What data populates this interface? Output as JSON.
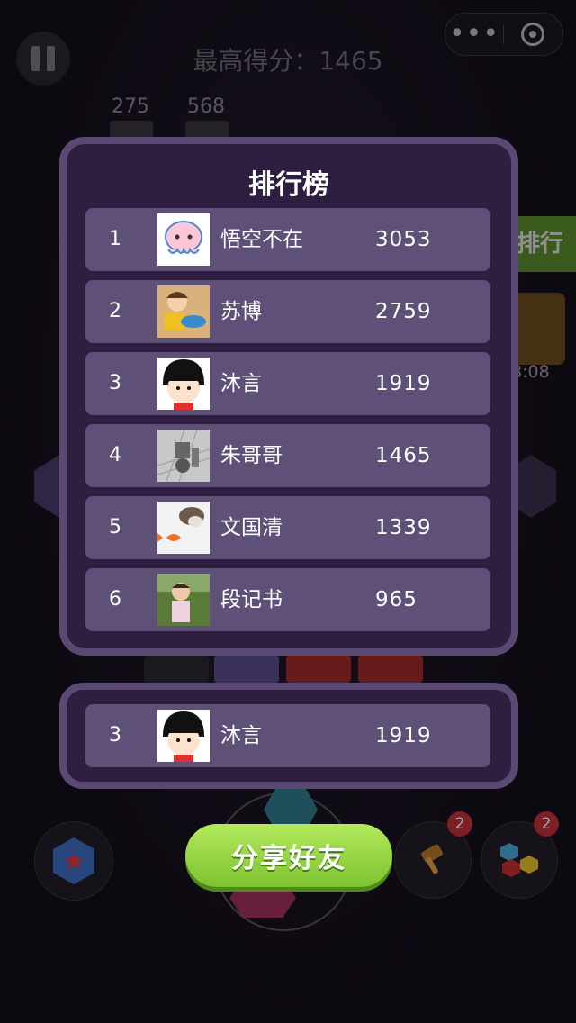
{
  "hud": {
    "best_score_label": "最高得分：1465",
    "score_a": "275",
    "score_b": "568"
  },
  "side": {
    "rank_tab_label": "排行",
    "gift_timer": "8:08"
  },
  "leaderboard": {
    "title": "排行榜",
    "rows": [
      {
        "rank": "1",
        "name": "悟空不在",
        "score": "3053",
        "avatar": "octopus-avatar"
      },
      {
        "rank": "2",
        "name": "苏博",
        "score": "2759",
        "avatar": "cartoon-boy-avatar"
      },
      {
        "rank": "3",
        "name": "沐言",
        "score": "1919",
        "avatar": "maruko-avatar"
      },
      {
        "rank": "4",
        "name": "朱哥哥",
        "score": "1465",
        "avatar": "chess-pieces-avatar"
      },
      {
        "rank": "5",
        "name": "文国清",
        "score": "1339",
        "avatar": "cat-goldfish-avatar"
      },
      {
        "rank": "6",
        "name": "段记书",
        "score": "965",
        "avatar": "child-photo-avatar"
      }
    ]
  },
  "self_entry": {
    "rank": "3",
    "name": "沐言",
    "score": "1919",
    "avatar": "maruko-avatar"
  },
  "bottom": {
    "share_label": "分享好友",
    "hammer_badge": "2",
    "blocks_badge": "2"
  },
  "colors": {
    "panel_bg": "#2e1f40",
    "panel_border": "#5a4a73",
    "row_bg": "#5e5076",
    "share_green": "#8fd13e"
  }
}
